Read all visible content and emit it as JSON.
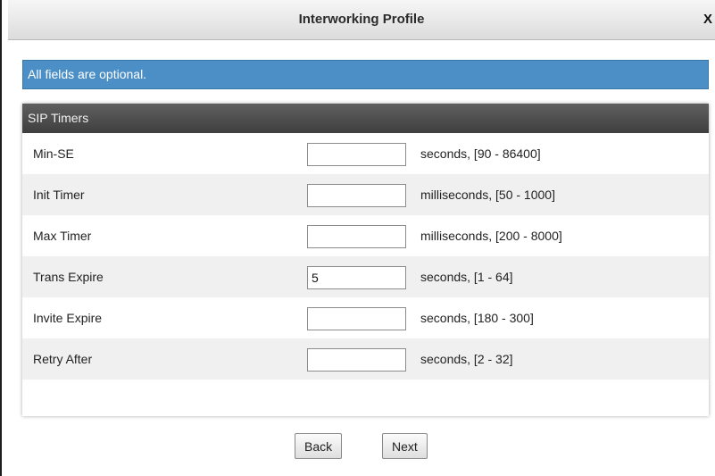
{
  "dialog": {
    "title": "Interworking Profile",
    "close_label": "X"
  },
  "info": {
    "text": "All fields are optional."
  },
  "section": {
    "title": "SIP Timers"
  },
  "fields": [
    {
      "label": "Min-SE",
      "value": "",
      "hint": "seconds, [90 - 86400]"
    },
    {
      "label": "Init Timer",
      "value": "",
      "hint": "milliseconds, [50 - 1000]"
    },
    {
      "label": "Max Timer",
      "value": "",
      "hint": "milliseconds, [200 - 8000]"
    },
    {
      "label": "Trans Expire",
      "value": "5",
      "hint": "seconds, [1 - 64]"
    },
    {
      "label": "Invite Expire",
      "value": "",
      "hint": "seconds, [180 - 300]"
    },
    {
      "label": "Retry After",
      "value": "",
      "hint": "seconds, [2 - 32]"
    }
  ],
  "buttons": {
    "back": "Back",
    "next": "Next"
  },
  "colors": {
    "banner": "#4b8fc6",
    "section_header": "#4a4a4a",
    "row_alt": "#f0f0f0"
  }
}
